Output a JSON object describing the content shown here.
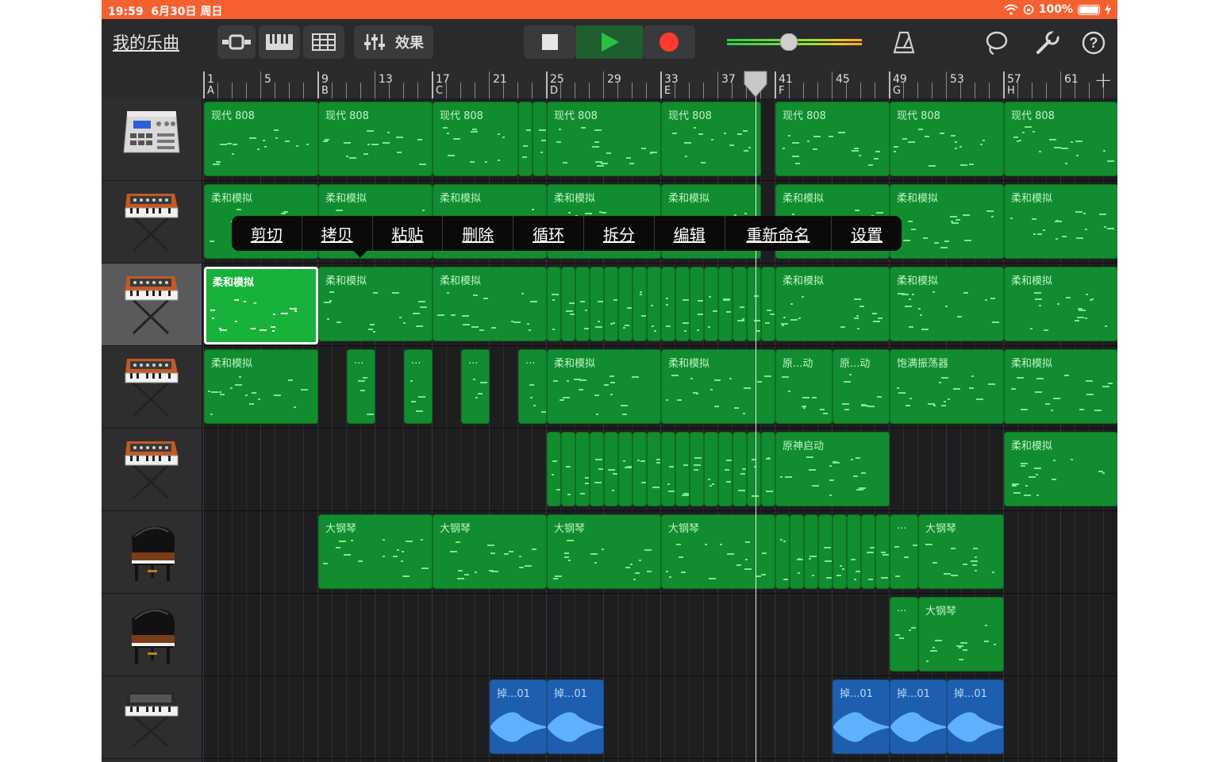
{
  "status": {
    "time": "19:59",
    "date": "6月30日 周日",
    "battery": "100%"
  },
  "toolbar": {
    "my_songs": "我的乐曲",
    "effects": "效果"
  },
  "ruler": {
    "bars": [
      "1",
      "5",
      "9",
      "13",
      "17",
      "21",
      "25",
      "29",
      "33",
      "37",
      "41",
      "45",
      "49",
      "53",
      "57",
      "61"
    ],
    "sections": [
      "A",
      "B",
      "C",
      "D",
      "E",
      "F",
      "G",
      "H"
    ],
    "add": "+"
  },
  "menu": {
    "items": [
      "剪切",
      "拷贝",
      "粘贴",
      "删除",
      "循环",
      "拆分",
      "编辑",
      "重新命名",
      "设置"
    ]
  },
  "tracks": [
    {
      "instrument": "drum-machine",
      "regions": [
        {
          "bar": 1,
          "len": 8,
          "label": "现代 808"
        },
        {
          "bar": 9,
          "len": 8,
          "label": "现代 808"
        },
        {
          "bar": 17,
          "len": 6,
          "label": "现代 808"
        },
        {
          "bar": 23,
          "len": 1,
          "label": ""
        },
        {
          "bar": 24,
          "len": 1,
          "label": ""
        },
        {
          "bar": 25,
          "len": 8,
          "label": "现代 808"
        },
        {
          "bar": 33,
          "len": 7,
          "label": "现代 808"
        },
        {
          "bar": 41,
          "len": 8,
          "label": "现代 808"
        },
        {
          "bar": 49,
          "len": 8,
          "label": "现代 808"
        },
        {
          "bar": 57,
          "len": 8,
          "label": "现代 808"
        }
      ]
    },
    {
      "instrument": "synth",
      "regions": [
        {
          "bar": 1,
          "len": 8,
          "label": "柔和模拟"
        },
        {
          "bar": 9,
          "len": 8,
          "label": "柔和模拟"
        },
        {
          "bar": 17,
          "len": 8,
          "label": "柔和模拟"
        },
        {
          "bar": 25,
          "len": 8,
          "label": "柔和模拟"
        },
        {
          "bar": 33,
          "len": 7,
          "label": "柔和模拟"
        },
        {
          "bar": 41,
          "len": 8,
          "label": "柔和模拟"
        },
        {
          "bar": 49,
          "len": 8,
          "label": "柔和模拟"
        },
        {
          "bar": 57,
          "len": 8,
          "label": "柔和模拟"
        }
      ]
    },
    {
      "instrument": "synth",
      "regions": [
        {
          "bar": 1,
          "len": 8,
          "label": "柔和模拟",
          "selected": true
        },
        {
          "bar": 9,
          "len": 8,
          "label": "柔和模拟"
        },
        {
          "bar": 17,
          "len": 8,
          "label": "柔和模拟"
        },
        {
          "bar": 25,
          "len": 1,
          "label": ""
        },
        {
          "bar": 26,
          "len": 1,
          "label": ""
        },
        {
          "bar": 27,
          "len": 1,
          "label": ""
        },
        {
          "bar": 28,
          "len": 1,
          "label": ""
        },
        {
          "bar": 29,
          "len": 1,
          "label": ""
        },
        {
          "bar": 30,
          "len": 1,
          "label": ""
        },
        {
          "bar": 31,
          "len": 1,
          "label": ""
        },
        {
          "bar": 32,
          "len": 1,
          "label": ""
        },
        {
          "bar": 33,
          "len": 1,
          "label": ""
        },
        {
          "bar": 34,
          "len": 1,
          "label": ""
        },
        {
          "bar": 35,
          "len": 1,
          "label": ""
        },
        {
          "bar": 36,
          "len": 1,
          "label": ""
        },
        {
          "bar": 37,
          "len": 1,
          "label": ""
        },
        {
          "bar": 38,
          "len": 1,
          "label": ""
        },
        {
          "bar": 39,
          "len": 1,
          "label": ""
        },
        {
          "bar": 40,
          "len": 1,
          "label": ""
        },
        {
          "bar": 41,
          "len": 8,
          "label": "柔和模拟"
        },
        {
          "bar": 49,
          "len": 8,
          "label": "柔和模拟"
        },
        {
          "bar": 57,
          "len": 8,
          "label": "柔和模拟"
        }
      ]
    },
    {
      "instrument": "synth",
      "regions": [
        {
          "bar": 1,
          "len": 8,
          "label": "柔和模拟"
        },
        {
          "bar": 11,
          "len": 2,
          "label": "..."
        },
        {
          "bar": 15,
          "len": 2,
          "label": "..."
        },
        {
          "bar": 19,
          "len": 2,
          "label": "..."
        },
        {
          "bar": 23,
          "len": 2,
          "label": "..."
        },
        {
          "bar": 25,
          "len": 8,
          "label": "柔和模拟"
        },
        {
          "bar": 33,
          "len": 8,
          "label": "柔和模拟"
        },
        {
          "bar": 41,
          "len": 4,
          "label": "原...动"
        },
        {
          "bar": 45,
          "len": 4,
          "label": "原...动"
        },
        {
          "bar": 49,
          "len": 8,
          "label": "饱满振荡器"
        },
        {
          "bar": 57,
          "len": 8,
          "label": "柔和模拟"
        }
      ]
    },
    {
      "instrument": "synth",
      "regions": [
        {
          "bar": 25,
          "len": 1,
          "label": ""
        },
        {
          "bar": 26,
          "len": 1,
          "label": ""
        },
        {
          "bar": 27,
          "len": 1,
          "label": ""
        },
        {
          "bar": 28,
          "len": 1,
          "label": ""
        },
        {
          "bar": 29,
          "len": 1,
          "label": ""
        },
        {
          "bar": 30,
          "len": 1,
          "label": ""
        },
        {
          "bar": 31,
          "len": 1,
          "label": ""
        },
        {
          "bar": 32,
          "len": 1,
          "label": ""
        },
        {
          "bar": 33,
          "len": 1,
          "label": ""
        },
        {
          "bar": 34,
          "len": 1,
          "label": ""
        },
        {
          "bar": 35,
          "len": 1,
          "label": ""
        },
        {
          "bar": 36,
          "len": 1,
          "label": ""
        },
        {
          "bar": 37,
          "len": 1,
          "label": ""
        },
        {
          "bar": 38,
          "len": 1,
          "label": ""
        },
        {
          "bar": 39,
          "len": 1,
          "label": ""
        },
        {
          "bar": 40,
          "len": 1,
          "label": ""
        },
        {
          "bar": 41,
          "len": 8,
          "label": "原神启动"
        },
        {
          "bar": 57,
          "len": 8,
          "label": "柔和模拟"
        }
      ]
    },
    {
      "instrument": "piano",
      "regions": [
        {
          "bar": 9,
          "len": 8,
          "label": "大钢琴"
        },
        {
          "bar": 17,
          "len": 8,
          "label": "大钢琴"
        },
        {
          "bar": 25,
          "len": 8,
          "label": "大钢琴"
        },
        {
          "bar": 33,
          "len": 8,
          "label": "大钢琴"
        },
        {
          "bar": 41,
          "len": 1,
          "label": ""
        },
        {
          "bar": 42,
          "len": 1,
          "label": ""
        },
        {
          "bar": 43,
          "len": 1,
          "label": ""
        },
        {
          "bar": 44,
          "len": 1,
          "label": ""
        },
        {
          "bar": 45,
          "len": 1,
          "label": ""
        },
        {
          "bar": 46,
          "len": 1,
          "label": ""
        },
        {
          "bar": 47,
          "len": 1,
          "label": ""
        },
        {
          "bar": 48,
          "len": 1,
          "label": ""
        },
        {
          "bar": 49,
          "len": 2,
          "label": "..."
        },
        {
          "bar": 51,
          "len": 6,
          "label": "大钢琴"
        }
      ]
    },
    {
      "instrument": "piano",
      "regions": [
        {
          "bar": 49,
          "len": 2,
          "label": "..."
        },
        {
          "bar": 51,
          "len": 6,
          "label": "大钢琴"
        }
      ]
    },
    {
      "instrument": "keyboard",
      "regions": [
        {
          "bar": 21,
          "len": 4,
          "label": "掉...01",
          "audio": true
        },
        {
          "bar": 25,
          "len": 4,
          "label": "掉...01",
          "audio": true
        },
        {
          "bar": 45,
          "len": 4,
          "label": "掉...01",
          "audio": true
        },
        {
          "bar": 49,
          "len": 4,
          "label": "掉...01",
          "audio": true
        },
        {
          "bar": 53,
          "len": 4,
          "label": "掉...01",
          "audio": true
        }
      ]
    }
  ]
}
